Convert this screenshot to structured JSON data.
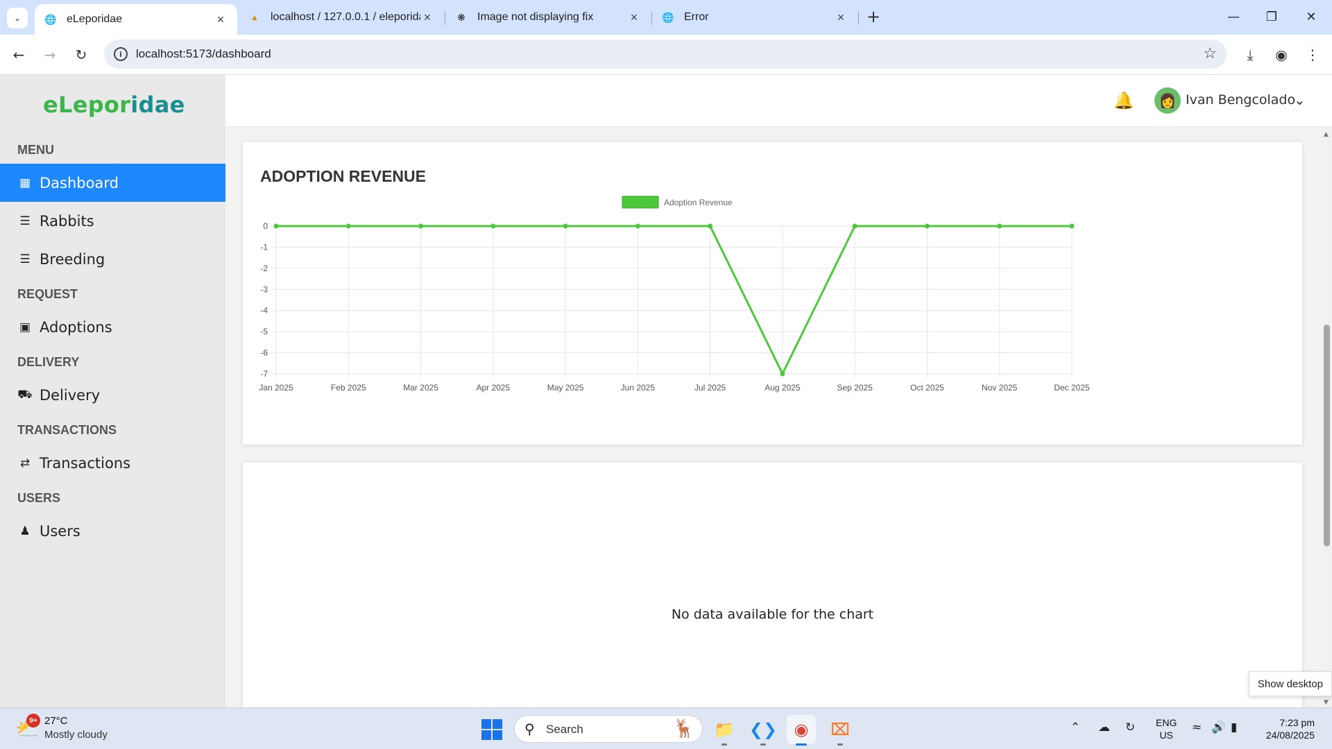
{
  "browser": {
    "tabs": [
      {
        "title": "eLeporidae",
        "icon": "globe-icon"
      },
      {
        "title": "localhost / 127.0.0.1 / eleporida",
        "icon": "phpmyadmin-icon"
      },
      {
        "title": "Image not displaying fix",
        "icon": "openai-icon"
      },
      {
        "title": "Error",
        "icon": "globe-icon"
      }
    ],
    "url": "localhost:5173/dashboard"
  },
  "sidebar": {
    "logo_part1": "eLepor",
    "logo_part2": "idae",
    "sections": {
      "menu": "MENU",
      "request": "REQUEST",
      "delivery": "DELIVERY",
      "transactions": "TRANSACTIONS",
      "users": "USERS"
    },
    "items": {
      "dashboard": "Dashboard",
      "rabbits": "Rabbits",
      "breeding": "Breeding",
      "adoptions": "Adoptions",
      "delivery": "Delivery",
      "transactions": "Transactions",
      "users": "Users"
    }
  },
  "header": {
    "user_name": "Ivan Bengcolado"
  },
  "revenue_card": {
    "title": "ADOPTION REVENUE"
  },
  "chart_data": {
    "type": "line",
    "title": "",
    "categories": [
      "Jan 2025",
      "Feb 2025",
      "Mar 2025",
      "Apr 2025",
      "May 2025",
      "Jun 2025",
      "Jul 2025",
      "Aug 2025",
      "Sep 2025",
      "Oct 2025",
      "Nov 2025",
      "Dec 2025"
    ],
    "series": [
      {
        "name": "Adoption Revenue",
        "values": [
          0,
          0,
          0,
          0,
          0,
          0,
          0,
          -7,
          0,
          0,
          0,
          0
        ],
        "color": "#4cc93a"
      }
    ],
    "yticks": [
      0,
      -1,
      -2,
      -3,
      -4,
      -5,
      -6,
      -7
    ],
    "ylim": [
      -7,
      0
    ],
    "grid": true,
    "legend": "top"
  },
  "second_card": {
    "message": "No data available for the chart"
  },
  "overlay": {
    "show_desktop": "Show desktop"
  },
  "taskbar": {
    "badge": "9+",
    "temperature": "27°C",
    "condition": "Mostly cloudy",
    "search_label": "Search",
    "lang_top": "ENG",
    "lang_bottom": "US",
    "time": "7:23 pm",
    "date": "24/08/2025"
  }
}
